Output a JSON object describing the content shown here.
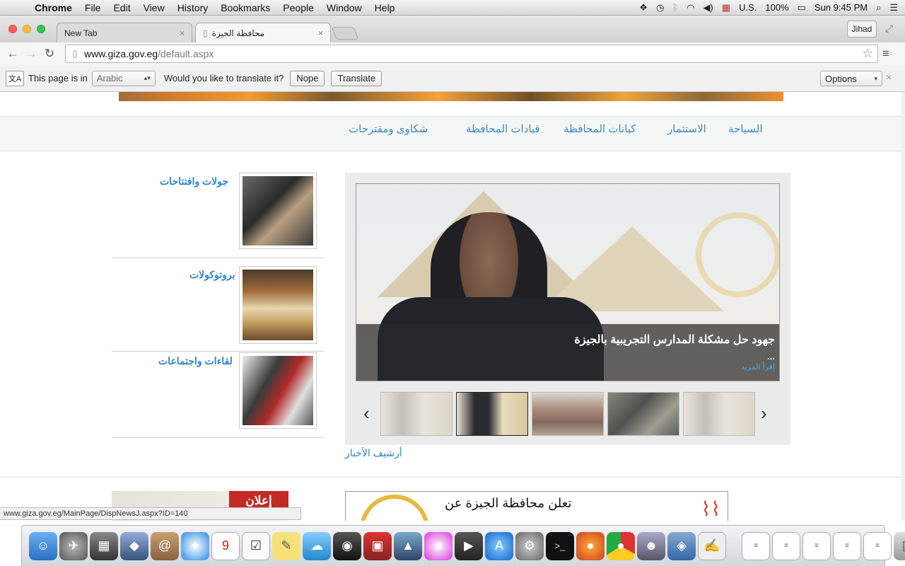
{
  "menubar": {
    "app": "Chrome",
    "items": [
      "File",
      "Edit",
      "View",
      "History",
      "Bookmarks",
      "People",
      "Window",
      "Help"
    ],
    "input_source": "U.S.",
    "battery": "100%",
    "clock": "Sun 9:45 PM"
  },
  "tabs": [
    {
      "title": "New Tab",
      "close": "×"
    },
    {
      "title": "محافظة الجيزة",
      "close": "×"
    }
  ],
  "profile": "Jihad",
  "address": {
    "domain": "www.giza.gov.eg",
    "path": "/default.aspx"
  },
  "translate_bar": {
    "prefix": "This page is in",
    "language": "Arabic",
    "question": "Would you like to translate it?",
    "nope": "Nope",
    "translate": "Translate",
    "options": "Options"
  },
  "nav": {
    "items": [
      "السياحة",
      "الاستثمار",
      "كيانات المحافظة",
      "قيادات المحافظة",
      "شكاوى ومقترحات"
    ]
  },
  "side_news": [
    {
      "title": "جولات وافتتاحات"
    },
    {
      "title": "بروتوكولات"
    },
    {
      "title": "لقاءات واجتماعات"
    }
  ],
  "slider": {
    "headline": "جهود حل مشكلة المدارس التجريبية بالجيزة",
    "ellipsis": "...",
    "read_more": "إقرأ المزيد",
    "prev": "‹",
    "next": "›"
  },
  "archive_link": "أرشيف الأخبار",
  "ads": {
    "left_tag": "إعلان",
    "right_text": "تعلن محافظة الجيزة عن"
  },
  "status_url": "www.giza.gov.eg/MainPage/DispNewsJ.aspx?ID=140",
  "colors": {
    "link_blue": "#2f86c3",
    "ad_red": "#c42a24"
  }
}
